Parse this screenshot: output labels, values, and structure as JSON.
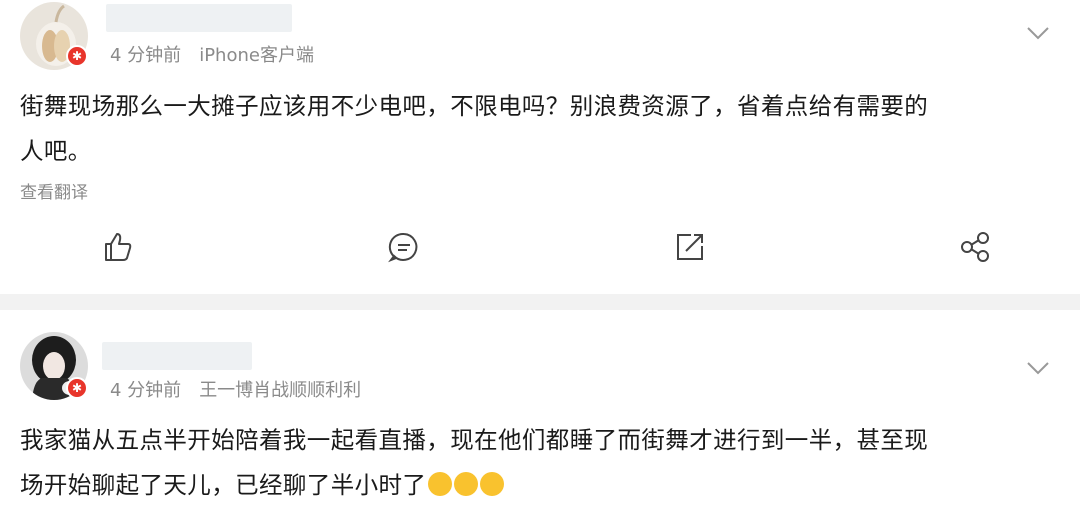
{
  "posts": [
    {
      "time": "4 分钟前",
      "source": "iPhone客户端",
      "text_line1": "街舞现场那么一大摊子应该用不少电吧，不限电吗？别浪费资源了，省着点给有需要的",
      "text_line2": "人吧。",
      "translate_label": "查看翻译"
    },
    {
      "time": "4 分钟前",
      "source": "王一博肖战顺顺利利",
      "text_line1": "我家猫从五点半开始陪着我一起看直播，现在他们都睡了而街舞才进行到一半，甚至现",
      "text_line2": "场开始聊起了天儿，已经聊了半小时了"
    }
  ],
  "icons": [
    "like-icon",
    "comment-icon",
    "repost-icon",
    "share-icon",
    "chevron-down-icon"
  ],
  "colors": {
    "badge": "#e8352b",
    "meta": "#8a8a8a",
    "divider": "#f2f2f2",
    "emoji": "#f9c22e"
  }
}
